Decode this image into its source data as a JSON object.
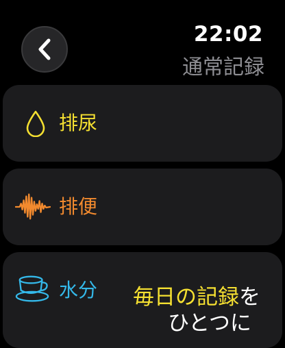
{
  "status": {
    "time": "22:02"
  },
  "screen": {
    "title": "通常記録"
  },
  "menu": {
    "items": [
      {
        "label": "排尿",
        "icon": "droplet-icon",
        "color": "#f5e031"
      },
      {
        "label": "排便",
        "icon": "waveform-icon",
        "color": "#f28a2e"
      },
      {
        "label": "水分",
        "icon": "cup-icon",
        "color": "#34b9ea"
      }
    ]
  },
  "caption": {
    "line1_part1": "毎日の",
    "line1_part2": "記録",
    "line1_part3": "を",
    "line2": "ひとつに"
  },
  "colors": {
    "background": "#000000",
    "card": "#1c1c1e",
    "secondary_text": "#8e8e93",
    "highlight": "#f5e031"
  }
}
